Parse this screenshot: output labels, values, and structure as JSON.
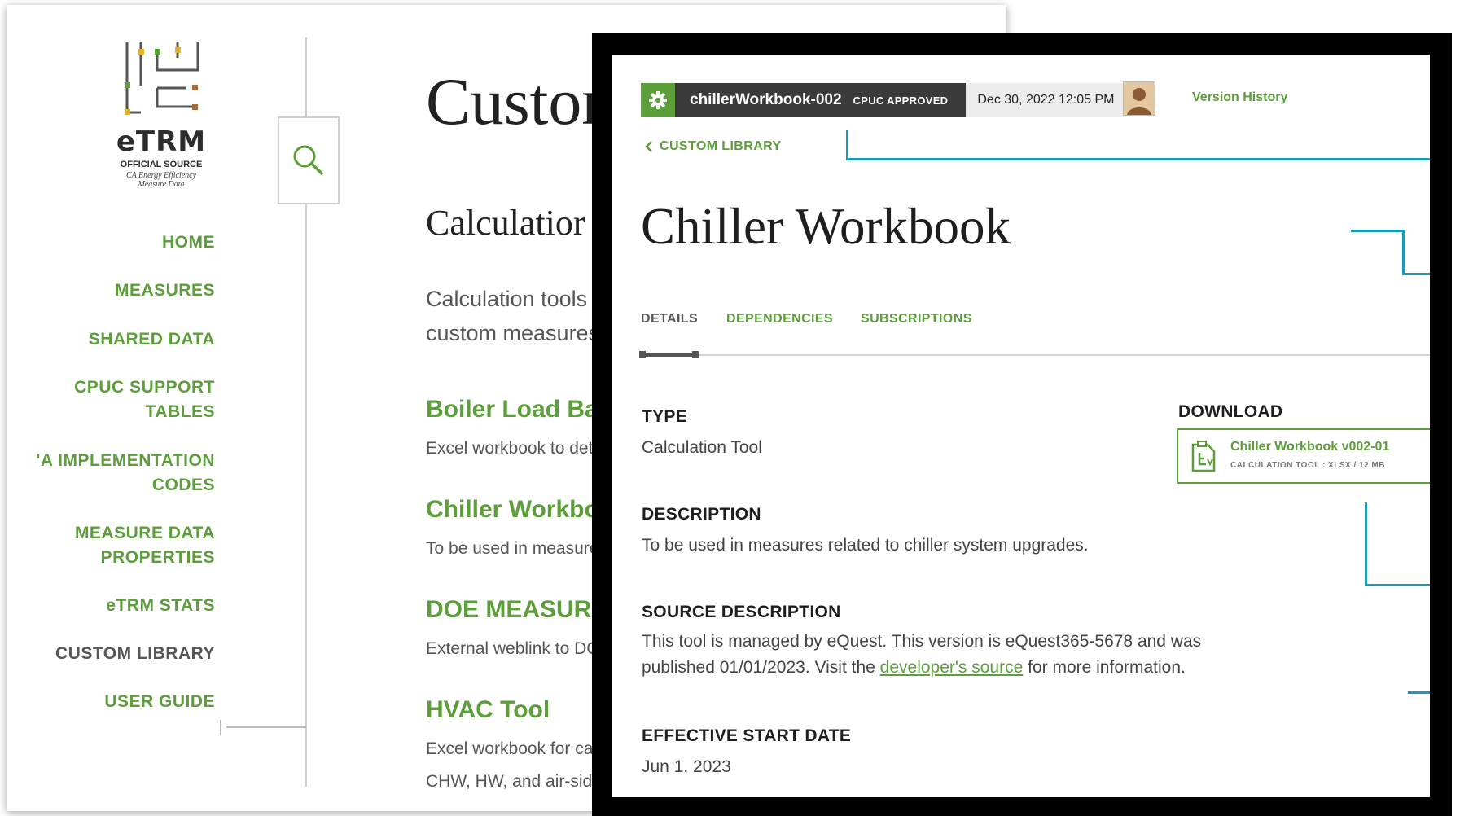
{
  "sidebar": {
    "logo": {
      "wordmark": "eTRM",
      "official": "OFFICIAL SOURCE",
      "subtitle_line1": "CA Energy Efficiency",
      "subtitle_line2": "Measure Data"
    },
    "nav": [
      {
        "label": "HOME"
      },
      {
        "label": "MEASURES"
      },
      {
        "label": "SHARED DATA"
      },
      {
        "label": "CPUC SUPPORT"
      },
      {
        "label": "TABLES"
      },
      {
        "label": "'A IMPLEMENTATION"
      },
      {
        "label": "CODES"
      },
      {
        "label": "MEASURE DATA"
      },
      {
        "label": "PROPERTIES"
      },
      {
        "label": "eTRM STATS"
      },
      {
        "label": "CUSTOM LIBRARY",
        "active": true
      },
      {
        "label": "USER GUIDE"
      }
    ]
  },
  "background_page": {
    "title": "Custor",
    "subtitle": "Calculatior",
    "intro_line1": "Calculation tools",
    "intro_line2": "custom measures",
    "tools": [
      {
        "title": "Boiler Load Ba",
        "desc": "Excel workbook to det"
      },
      {
        "title": "Chiller Workbo",
        "desc": "To be used in measure"
      },
      {
        "title": "DOE MEASUR",
        "desc": "External weblink to DC"
      },
      {
        "title": "HVAC Tool",
        "desc": "Excel workbook for ca",
        "desc2": "CHW, HW, and air-side"
      }
    ]
  },
  "detail": {
    "header": {
      "workbook_id": "chillerWorkbook-002",
      "badge": "CPUC APPROVED",
      "datetime": "Dec 30, 2022 12:05 PM",
      "version_history": "Version History"
    },
    "back_link": "CUSTOM LIBRARY",
    "title": "Chiller Workbook",
    "tabs": [
      {
        "label": "DETAILS",
        "active": true
      },
      {
        "label": "DEPENDENCIES",
        "active": false
      },
      {
        "label": "SUBSCRIPTIONS",
        "active": false
      }
    ],
    "fields": {
      "type_label": "TYPE",
      "type_value": "Calculation Tool",
      "description_label": "DESCRIPTION",
      "description_value": "To be used in measures related to chiller system upgrades.",
      "source_label": "SOURCE DESCRIPTION",
      "source_line1": "This tool is managed by eQuest. This version is eQuest365-5678 and was",
      "source_line2_pre": "published 01/01/2023. Visit the ",
      "source_link": "developer's source",
      "source_line2_post": " for more information.",
      "start_label": "EFFECTIVE START DATE",
      "start_value": "Jun 1, 2023"
    },
    "download": {
      "label": "DOWNLOAD",
      "file_name": "Chiller Workbook v002-01",
      "file_meta": "CALCULATION TOOL  :  XLSX / 12 MB"
    }
  },
  "colors": {
    "accent_green": "#5c9e3a",
    "dark_bar": "#3a3a3a",
    "teal_lines": "#1a9bb3"
  },
  "icons": [
    "search-icon",
    "gear-icon",
    "chevron-left-icon",
    "avatar",
    "file-download-icon",
    "etrm-logo"
  ]
}
